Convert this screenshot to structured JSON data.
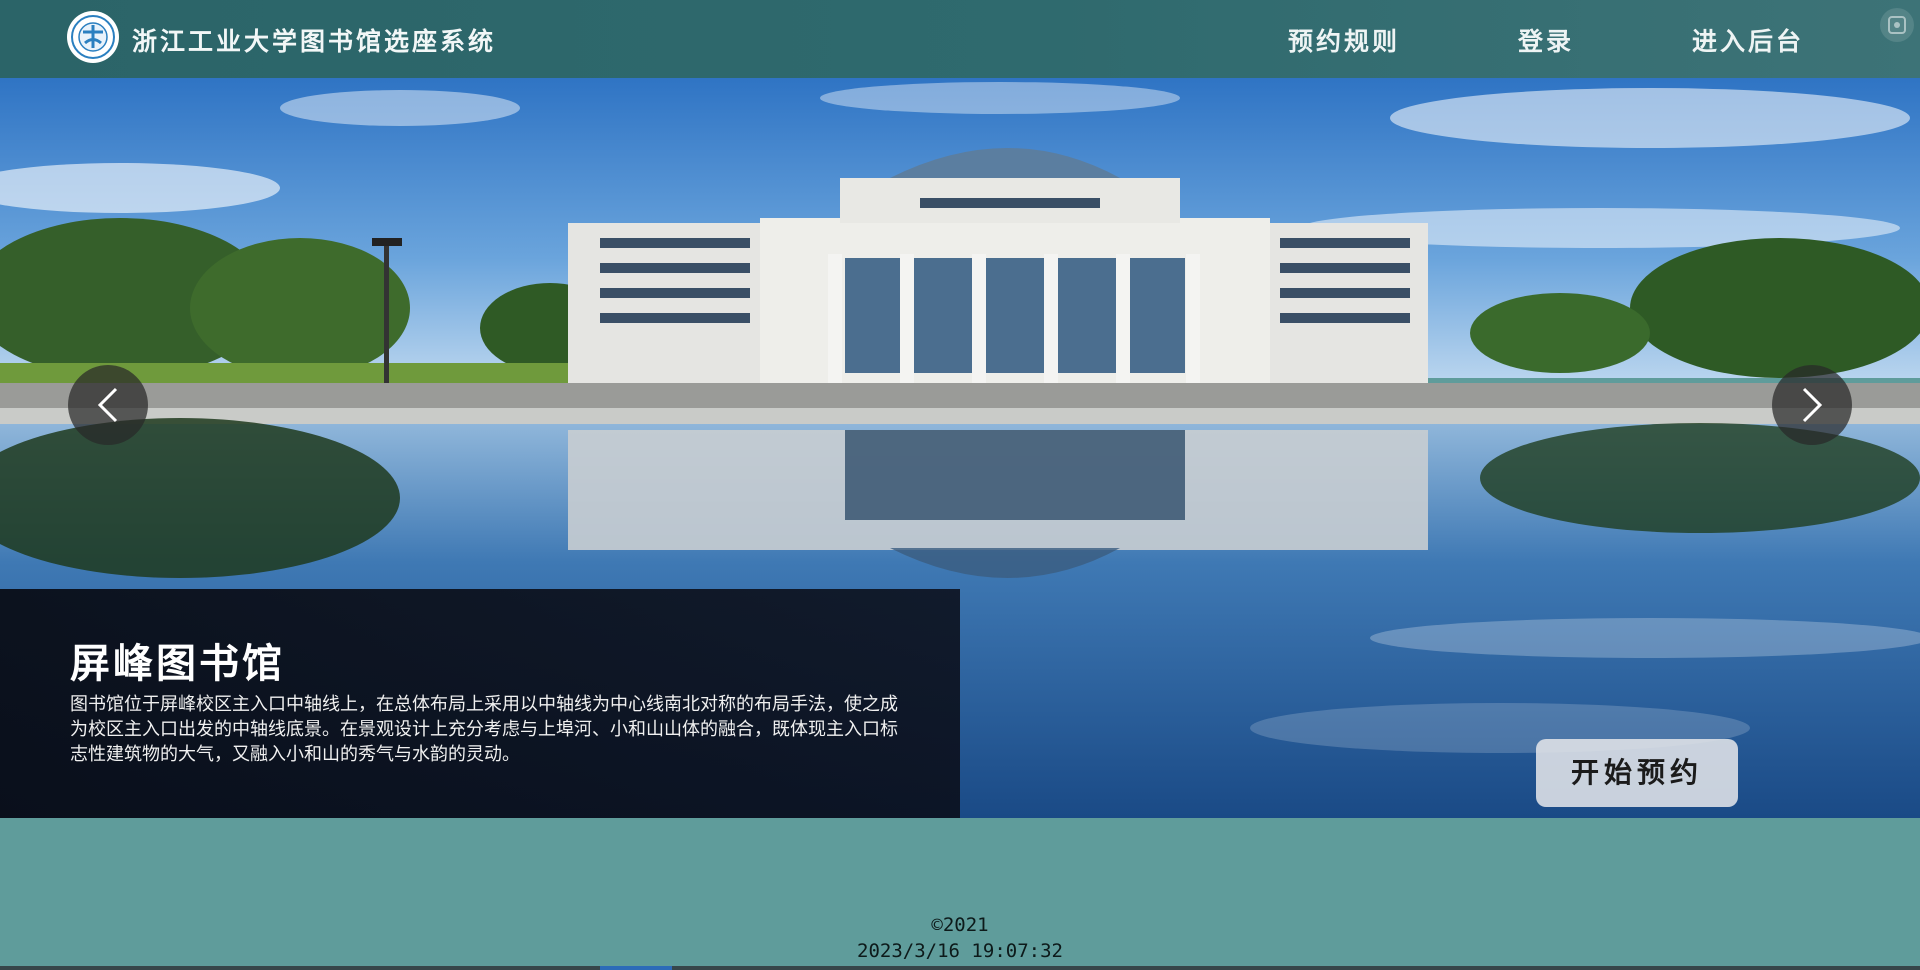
{
  "header": {
    "title": "浙江工业大学图书馆选座系统",
    "logo_icon": "university-seal-icon",
    "nav": {
      "rules": "预约规则",
      "login": "登录",
      "admin": "进入后台"
    },
    "corner_icon": "screenshot-icon"
  },
  "hero": {
    "prev_icon": "chevron-left-icon",
    "next_icon": "chevron-right-icon",
    "caption_title": "屏峰图书馆",
    "caption_desc": "图书馆位于屏峰校区主入口中轴线上，在总体布局上采用以中轴线为中心线南北对称的布局手法，使之成为校区主入口出发的中轴线底景。在景观设计上充分考虑与上埠河、小和山山体的融合，既体现主入口标志性建筑物的大气，又融入小和山的秀气与水韵的灵动。",
    "start_button": "开始预约"
  },
  "footer": {
    "copyright": "©2021",
    "datetime": "2023/3/16 19:07:32"
  },
  "colors": {
    "header_bg": "#2f6a6e",
    "page_bg": "#5f9c9b",
    "caption_bg": "#0a0c16"
  }
}
